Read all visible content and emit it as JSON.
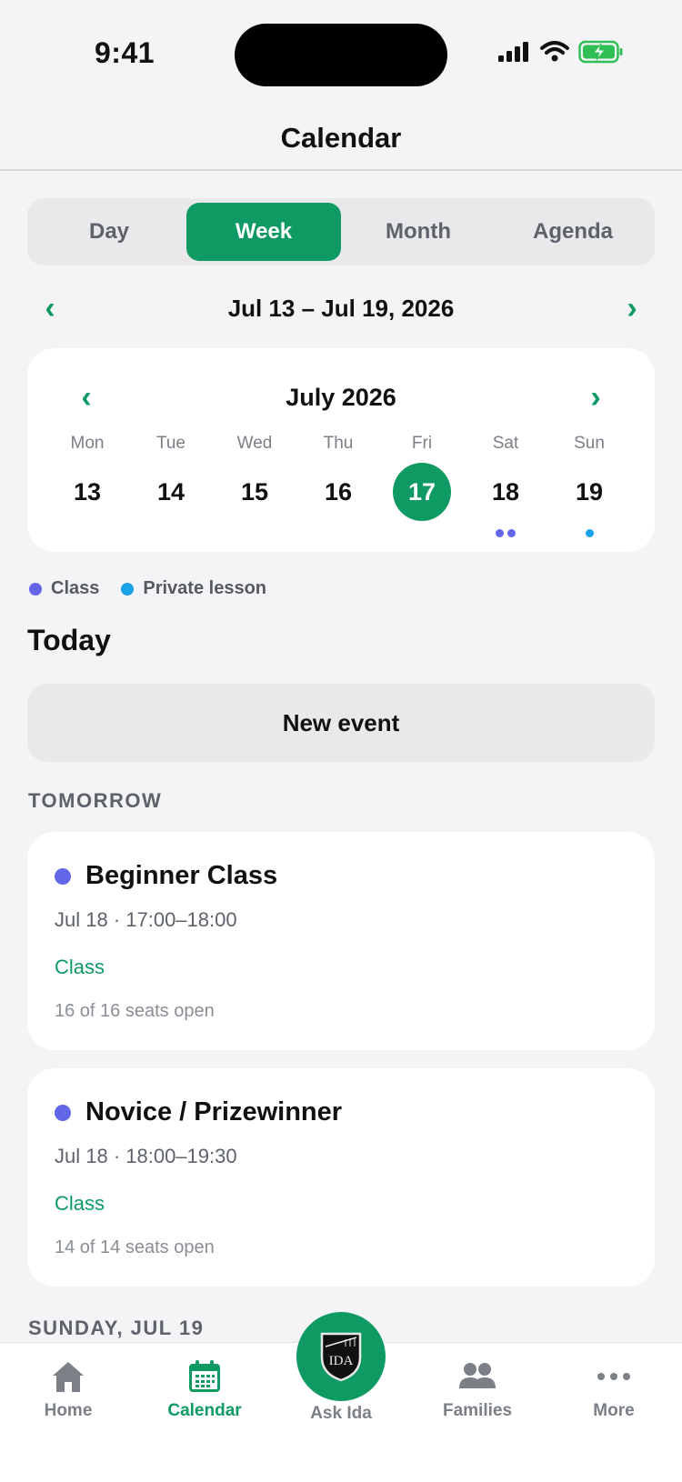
{
  "status": {
    "time": "9:41"
  },
  "header": {
    "title": "Calendar"
  },
  "view_tabs": [
    "Day",
    "Week",
    "Month",
    "Agenda"
  ],
  "week_range": "Jul 13 – Jul 19, 2026",
  "mini_calendar": {
    "month_label": "July 2026",
    "days": [
      {
        "dow": "Mon",
        "num": "13"
      },
      {
        "dow": "Tue",
        "num": "14"
      },
      {
        "dow": "Wed",
        "num": "15"
      },
      {
        "dow": "Thu",
        "num": "16"
      },
      {
        "dow": "Fri",
        "num": "17"
      },
      {
        "dow": "Sat",
        "num": "18"
      },
      {
        "dow": "Sun",
        "num": "19"
      }
    ]
  },
  "legend": {
    "class_label": "Class",
    "private_label": "Private lesson"
  },
  "colors": {
    "accent": "#0f9a64",
    "class": "#6366e8",
    "private_lesson": "#1aa3e8"
  },
  "today_title": "Today",
  "new_event_label": "New event",
  "sections": {
    "tomorrow": "TOMORROW",
    "sunday": "SUNDAY, JUL 19"
  },
  "events": [
    {
      "title": "Beginner Class",
      "time": "Jul 18 · 17:00–18:00",
      "type": "Class",
      "seats": "16 of 16 seats open"
    },
    {
      "title": "Novice / Prizewinner",
      "time": "Jul 18 · 18:00–19:30",
      "type": "Class",
      "seats": "14 of 14 seats open"
    }
  ],
  "tabbar": {
    "home": "Home",
    "calendar": "Calendar",
    "ask": "Ask Ida",
    "families": "Families",
    "more": "More",
    "logo_text": "IDA"
  }
}
